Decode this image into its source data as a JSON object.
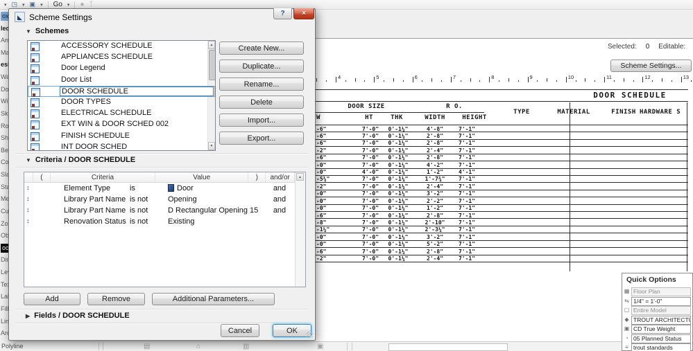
{
  "icons": {
    "caret": "▾",
    "publisher": "◳",
    "view_switch": "▣",
    "globe": "●",
    "person": "ᛉ",
    "help": "?",
    "close": "×",
    "up": "▲",
    "down": "▼",
    "sort": "↕",
    "tri_open": "▼",
    "tri_closed": "▶",
    "logo": "◣"
  },
  "toolbar": {
    "go_label": "Go"
  },
  "toolbox": {
    "items": [
      {
        "label": "ox",
        "kind": "tab"
      },
      {
        "label": "lect",
        "kind": "header"
      },
      {
        "label": "Arr",
        "kind": "item"
      },
      {
        "label": "Mar",
        "kind": "item"
      },
      {
        "label": "esig",
        "kind": "header"
      },
      {
        "label": "Wa",
        "kind": "item"
      },
      {
        "label": "Do",
        "kind": "item"
      },
      {
        "label": "Win",
        "kind": "item"
      },
      {
        "label": "Sky",
        "kind": "item"
      },
      {
        "label": "Ro",
        "kind": "item"
      },
      {
        "label": "She",
        "kind": "item"
      },
      {
        "label": "Bea",
        "kind": "item"
      },
      {
        "label": "Col",
        "kind": "item"
      },
      {
        "label": "Sla",
        "kind": "item"
      },
      {
        "label": "Sta",
        "kind": "item"
      },
      {
        "label": "Mes",
        "kind": "item"
      },
      {
        "label": "Cur",
        "kind": "item"
      },
      {
        "label": "Zon",
        "kind": "item"
      },
      {
        "label": "Obj",
        "kind": "item"
      },
      {
        "label": "ocum",
        "kind": "dark"
      },
      {
        "label": "Dim",
        "kind": "item"
      },
      {
        "label": "Lev",
        "kind": "item"
      },
      {
        "label": "Tex",
        "kind": "item"
      },
      {
        "label": "Lab",
        "kind": "item"
      },
      {
        "label": "Fill",
        "kind": "item"
      },
      {
        "label": "Line",
        "kind": "item"
      },
      {
        "label": "Arc",
        "kind": "item"
      }
    ],
    "bottom_label": "Polyline"
  },
  "dialog": {
    "title": "Scheme Settings",
    "sections": {
      "schemes": "Schemes",
      "criteria": "Criteria / DOOR SCHEDULE",
      "fields": "Fields / DOOR SCHEDULE"
    },
    "schemes": [
      {
        "label": "ACCESSORY SCHEDULE"
      },
      {
        "label": "APPLIANCES SCHEDULE"
      },
      {
        "label": "Door Legend"
      },
      {
        "label": "Door List"
      },
      {
        "label": "DOOR SCHEDULE",
        "selected": true
      },
      {
        "label": "DOOR TYPES"
      },
      {
        "label": "ELECTRICAL SCHEDULE"
      },
      {
        "label": "EXT WIN & DOOR SCHED 002"
      },
      {
        "label": "FINISH SCHEDULE"
      },
      {
        "label": "INT DOOR SCHED"
      }
    ],
    "actions": [
      "Create New...",
      "Duplicate...",
      "Rename...",
      "Delete",
      "Import...",
      "Export..."
    ],
    "criteria": {
      "headers": [
        "(",
        "Criteria",
        "Value",
        ")",
        "and/or"
      ],
      "rows": [
        {
          "name": "Element Type",
          "op": "is",
          "value": "Door",
          "icon": "door",
          "andor": "and"
        },
        {
          "name": "Library Part Name",
          "op": "is not",
          "value": "Opening",
          "andor": "and"
        },
        {
          "name": "Library Part Name",
          "op": "is not",
          "value": "D Rectangular Opening 15",
          "andor": "and"
        },
        {
          "name": "Renovation Status",
          "op": "is not",
          "value": "Existing",
          "andor": ""
        }
      ]
    },
    "buttons": {
      "add": "Add",
      "remove": "Remove",
      "additional": "Additional Parameters...",
      "cancel": "Cancel",
      "ok": "OK"
    }
  },
  "view": {
    "selected_label": "Selected:",
    "selected_count": "0",
    "editable_label": "Editable:",
    "scheme_settings_button": "Scheme Settings...",
    "ruler_numbers": [
      "4",
      "5",
      "6",
      "7",
      "8",
      "9",
      "10",
      "11",
      "12",
      "13"
    ]
  },
  "schedule": {
    "title": "DOOR SCHEDULE",
    "group_door_size": "DOOR SIZE",
    "group_ro": "R O.",
    "size_columns": [
      "W",
      "HT",
      "THK",
      "WIDTH",
      "HEIGHT"
    ],
    "info_columns": [
      "TYPE",
      "MATERIAL",
      "FINISH",
      "HARDWARE S"
    ],
    "rows": [
      [
        "-6\"",
        "7'-0\"",
        "0'-1¼\"",
        "4'-8\"",
        "7'-1\""
      ],
      [
        "-6\"",
        "7'-0\"",
        "0'-1¼\"",
        "2'-8\"",
        "7'-1\""
      ],
      [
        "-6\"",
        "7'-0\"",
        "0'-1¼\"",
        "2'-8\"",
        "7'-1\""
      ],
      [
        "-2\"",
        "7'-0\"",
        "0'-1¼\"",
        "2'-4\"",
        "7'-1\""
      ],
      [
        "-6\"",
        "7'-0\"",
        "0'-1¼\"",
        "2'-8\"",
        "7'-1\""
      ],
      [
        "-0\"",
        "7'-0\"",
        "0'-1¼\"",
        "4'-2\"",
        "7'-1\""
      ],
      [
        "-0\"",
        "4'-0\"",
        "0'-1¼\"",
        "1'-2\"",
        "4'-1\""
      ],
      [
        "-5¾\"",
        "7'-0\"",
        "0'-1¼\"",
        "1'-7¾\"",
        "7'-1\""
      ],
      [
        "-2\"",
        "7'-0\"",
        "0'-1¼\"",
        "2'-4\"",
        "7'-1\""
      ],
      [
        "-0\"",
        "7'-0\"",
        "0'-1¼\"",
        "3'-2\"",
        "7'-1\""
      ],
      [
        "-0\"",
        "7'-0\"",
        "0'-1¼\"",
        "2'-2\"",
        "7'-1\""
      ],
      [
        "-0\"",
        "7'-0\"",
        "0'-1¼\"",
        "1'-2\"",
        "7'-1\""
      ],
      [
        "-6\"",
        "7'-0\"",
        "0'-1¼\"",
        "2'-8\"",
        "7'-1\""
      ],
      [
        "-8\"",
        "7'-0\"",
        "0'-1¼\"",
        "2'-10\"",
        "7'-1\""
      ],
      [
        "-1¼\"",
        "7'-0\"",
        "0'-1¼\"",
        "2'-3¼\"",
        "7'-1\""
      ],
      [
        "-0\"",
        "7'-0\"",
        "0'-1¼\"",
        "3'-2\"",
        "7'-1\""
      ],
      [
        "-0\"",
        "7'-0\"",
        "0'-1¼\"",
        "5'-2\"",
        "7'-1\""
      ],
      [
        "-6\"",
        "7'-0\"",
        "0'-1¼\"",
        "2'-8\"",
        "7'-1\""
      ],
      [
        "-2\"",
        "7'-0\"",
        "0'-1¼\"",
        "2'-4\"",
        "7'-1\""
      ]
    ]
  },
  "quick_options": {
    "title": "Quick Options",
    "items": [
      {
        "icon": "▦",
        "name": "floor-plan",
        "label": "Floor Plan",
        "disabled": true
      },
      {
        "icon": "⇆",
        "name": "scale",
        "label": "1/4\" =  1'-0\"",
        "disabled": false
      },
      {
        "icon": "▢",
        "name": "model-filter",
        "label": "Entire Model",
        "disabled": true
      },
      {
        "icon": "◆",
        "name": "pen-set",
        "label": "TROUT ARCHITECTUR...",
        "disabled": false
      },
      {
        "icon": "▣",
        "name": "layer-combination",
        "label": "CD True Weight",
        "disabled": false
      },
      {
        "icon": "◔",
        "name": "renovation-filter",
        "label": "05 Planned Status",
        "disabled": false
      },
      {
        "icon": "≡",
        "name": "favorites-standards",
        "label": "trout standards",
        "disabled": false
      }
    ]
  },
  "status": {
    "icons": [
      "▤",
      "⌂",
      "▥",
      "▣"
    ]
  }
}
